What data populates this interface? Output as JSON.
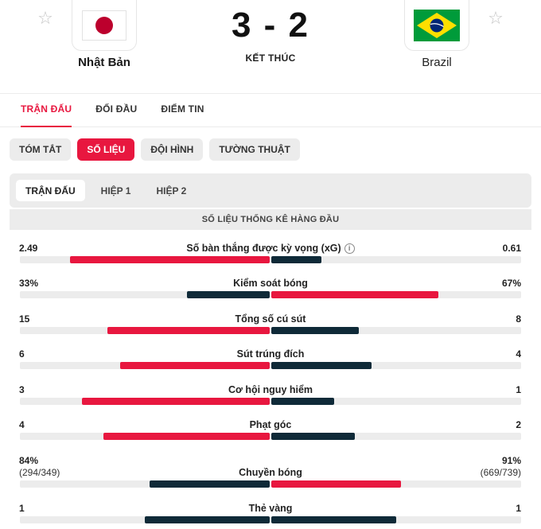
{
  "match": {
    "home": {
      "name": "Nhật Bản",
      "flag": "japan-flag"
    },
    "away": {
      "name": "Brazil",
      "flag": "brazil-flag"
    },
    "score": "3 - 2",
    "status": "KẾT THÚC"
  },
  "main_tabs": [
    {
      "label": "TRẬN ĐẤU",
      "active": true
    },
    {
      "label": "ĐỐI ĐẦU",
      "active": false
    },
    {
      "label": "ĐIỂM TIN",
      "active": false
    }
  ],
  "sub_tabs": [
    {
      "label": "TÓM TẮT",
      "active": false
    },
    {
      "label": "SỐ LIỆU",
      "active": true
    },
    {
      "label": "ĐỘI HÌNH",
      "active": false
    },
    {
      "label": "TƯỜNG THUẬT",
      "active": false
    }
  ],
  "periods": [
    {
      "label": "TRẬN ĐẤU",
      "active": true
    },
    {
      "label": "HIỆP 1",
      "active": false
    },
    {
      "label": "HIỆP 2",
      "active": false
    }
  ],
  "section_title": "SỐ LIỆU THỐNG KÊ HÀNG ĐẦU",
  "colors": {
    "accent": "#e8173f",
    "dark": "#0f2a38",
    "track": "#ececec"
  },
  "stats": [
    {
      "label": "Số bàn thắng được kỳ vọng (xG)",
      "info": true,
      "home": "2.49",
      "away": "0.61",
      "home_ratio": 0.8,
      "away_ratio": 0.2,
      "home_color": "red",
      "away_color": "dark"
    },
    {
      "label": "Kiểm soát bóng",
      "home": "33%",
      "away": "67%",
      "home_ratio": 0.33,
      "away_ratio": 0.67,
      "home_color": "dark",
      "away_color": "red"
    },
    {
      "label": "Tổng số cú sút",
      "home": "15",
      "away": "8",
      "home_ratio": 0.65,
      "away_ratio": 0.35,
      "home_color": "red",
      "away_color": "dark"
    },
    {
      "label": "Sút trúng đích",
      "home": "6",
      "away": "4",
      "home_ratio": 0.6,
      "away_ratio": 0.4,
      "home_color": "red",
      "away_color": "dark"
    },
    {
      "label": "Cơ hội nguy hiểm",
      "home": "3",
      "away": "1",
      "home_ratio": 0.75,
      "away_ratio": 0.25,
      "home_color": "red",
      "away_color": "dark"
    },
    {
      "label": "Phạt góc",
      "home": "4",
      "away": "2",
      "home_ratio": 0.667,
      "away_ratio": 0.333,
      "home_color": "red",
      "away_color": "dark"
    },
    {
      "label": "Chuyền bóng",
      "home": "84%",
      "home_sub": "(294/349)",
      "away": "91%",
      "away_sub": "(669/739)",
      "home_ratio": 0.48,
      "away_ratio": 0.52,
      "home_color": "dark",
      "away_color": "red"
    },
    {
      "label": "Thẻ vàng",
      "home": "1",
      "away": "1",
      "home_ratio": 0.5,
      "away_ratio": 0.5,
      "home_color": "dark",
      "away_color": "dark"
    }
  ]
}
